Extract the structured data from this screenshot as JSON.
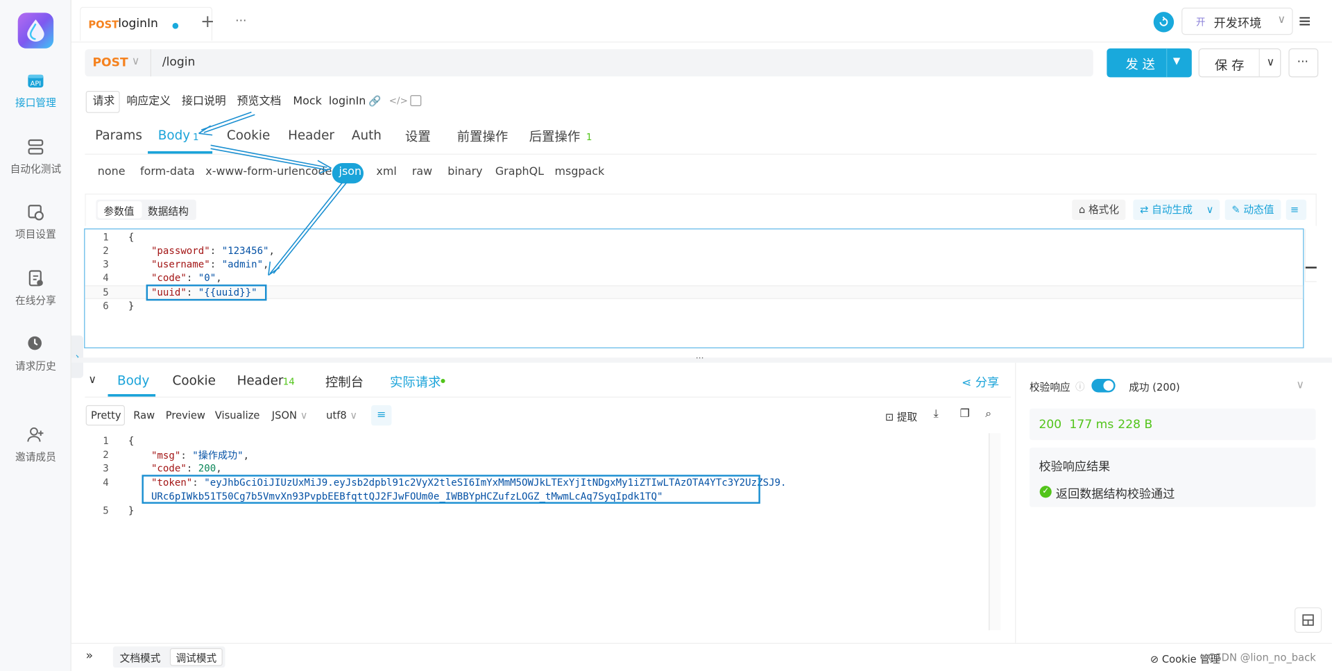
{
  "nav": {
    "items": [
      {
        "label": "接口管理",
        "icon": "api-icon",
        "active": true
      },
      {
        "label": "自动化测试",
        "icon": "automation-icon"
      },
      {
        "label": "项目设置",
        "icon": "settings-icon"
      },
      {
        "label": "在线分享",
        "icon": "share-doc-icon"
      },
      {
        "label": "请求历史",
        "icon": "history-icon"
      },
      {
        "label": "邀请成员",
        "icon": "invite-user-icon"
      }
    ]
  },
  "tabs": {
    "method": "POST",
    "name": "loginIn",
    "add": "+",
    "more": "···"
  },
  "env": {
    "badge": "开",
    "name": "开发环境"
  },
  "request": {
    "method": "POST",
    "url": "/login",
    "send": "发 送",
    "save": "保 存"
  },
  "subnav": {
    "items": [
      "请求",
      "响应定义",
      "接口说明",
      "预览文档",
      "Mock"
    ],
    "title": "loginIn"
  },
  "reqtabs": {
    "items": [
      "Params",
      "Body",
      "Cookie",
      "Header",
      "Auth",
      "设置",
      "前置操作",
      "后置操作"
    ],
    "body_count": "1",
    "post_count": "1"
  },
  "bodytypes": [
    "none",
    "form-data",
    "x-www-form-urlencoded",
    "json",
    "xml",
    "raw",
    "binary",
    "GraphQL",
    "msgpack"
  ],
  "editor_modes": [
    "参数值",
    "数据结构"
  ],
  "editor_tools": {
    "format": "格式化",
    "autogen": "自动生成",
    "dynamic": "动态值"
  },
  "req_code": {
    "l1": "{",
    "k1": "\"password\"",
    "v1": "\"123456\"",
    "k2": "\"username\"",
    "v2": "\"admin\"",
    "k3": "\"code\"",
    "v3": "\"0\"",
    "k4": "\"uuid\"",
    "v4": "\"{{uuid}}\"",
    "l6": "}"
  },
  "resp_tabs": {
    "body": "Body",
    "cookie": "Cookie",
    "header": "Header",
    "header_count": "14",
    "console": "控制台",
    "actual": "实际请求",
    "share": "分享"
  },
  "resp_view": {
    "modes": [
      "Pretty",
      "Raw",
      "Preview",
      "Visualize"
    ],
    "format": "JSON",
    "encoding": "utf8",
    "extract": "提取"
  },
  "resp_code": {
    "l1": "{",
    "k1": "\"msg\"",
    "v1": "\"操作成功\"",
    "k2": "\"code\"",
    "v2": "200",
    "k3": "\"token\"",
    "v3a": "\"eyJhbGciOiJIUzUxMiJ9.eyJsb2dpbl91c2VyX2tleSI6ImYxMmM5OWJkLTExYjItNDgxMy1iZTIwLTAzOTA4YTc3Y2UzZSJ9.",
    "v3b": "URc6pIWkb51T50Cg7b5VmvXn93PvpbEEBfqttQJ2FJwFOUm0e_IWBBYpHCZufzLOGZ_tMwmLcAq7SyqIpdk1TQ\"",
    "l5": "}"
  },
  "validate": {
    "label": "校验响应",
    "status": "成功 (200)",
    "code": "200",
    "time": "177 ms",
    "size": "228 B",
    "result_title": "校验响应结果",
    "result": "返回数据结构校验通过"
  },
  "footer": {
    "doc": "文档模式",
    "debug": "调试模式",
    "cookie": "Cookie 管理",
    "watermark": "CSDN @lion_no_back"
  },
  "colors": {
    "accent": "#1aa3d9",
    "post": "#f5821f",
    "success": "#52c41a"
  }
}
